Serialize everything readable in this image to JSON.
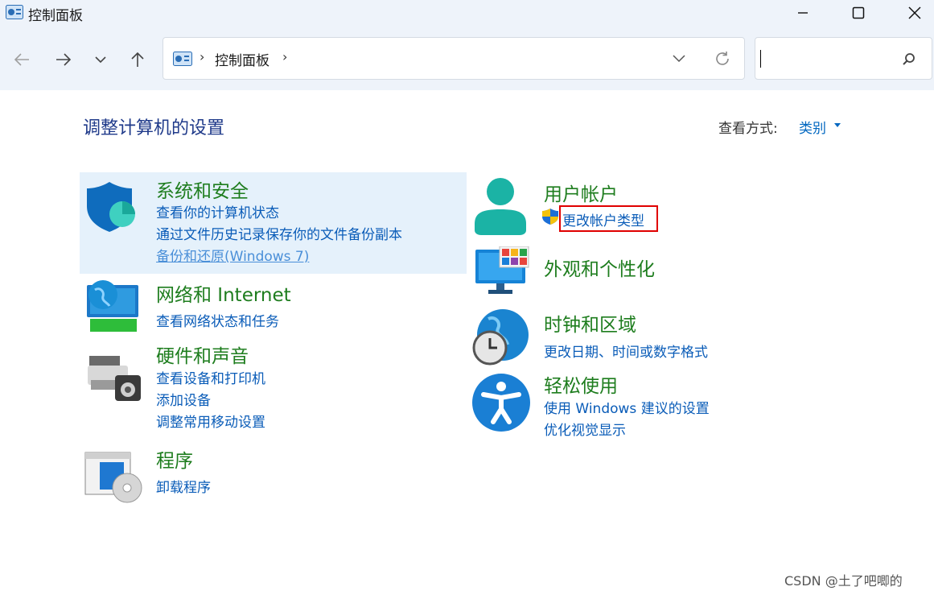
{
  "window": {
    "title": "控制面板"
  },
  "toolbar": {
    "breadcrumb": "控制面板",
    "search_placeholder": ""
  },
  "main": {
    "page_title": "调整计算机的设置",
    "view_by_label": "查看方式:",
    "view_by_value": "类别"
  },
  "categories": {
    "system": {
      "title": "系统和安全",
      "links": [
        "查看你的计算机状态",
        "通过文件历史记录保存你的文件备份副本",
        "备份和还原(Windows 7)"
      ]
    },
    "network": {
      "title": "网络和 Internet",
      "links": [
        "查看网络状态和任务"
      ]
    },
    "hardware": {
      "title": "硬件和声音",
      "links": [
        "查看设备和打印机",
        "添加设备",
        "调整常用移动设置"
      ]
    },
    "programs": {
      "title": "程序",
      "links": [
        "卸载程序"
      ]
    },
    "users": {
      "title": "用户帐户",
      "links": [
        "更改帐户类型"
      ]
    },
    "appearance": {
      "title": "外观和个性化",
      "links": []
    },
    "clock": {
      "title": "时钟和区域",
      "links": [
        "更改日期、时间或数字格式"
      ]
    },
    "ease": {
      "title": "轻松使用",
      "links": [
        "使用 Windows 建议的设置",
        "优化视觉显示"
      ]
    }
  },
  "watermark": "CSDN @土了吧唧的",
  "colors": {
    "title_green": "#1e7d1e",
    "link_blue": "#0a5cb8",
    "highlight": "#e5f1fb",
    "annotation_red": "#e00000"
  }
}
